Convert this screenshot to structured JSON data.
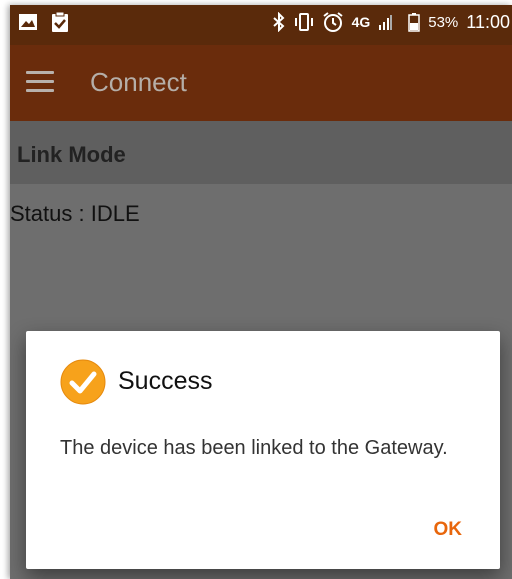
{
  "statusbar": {
    "battery": "53%",
    "time": "11:00",
    "network": "4G",
    "icons": [
      "image-icon",
      "clipboard-check-icon",
      "bluetooth-icon",
      "vibrate-icon",
      "alarm-icon",
      "signal-icon",
      "battery-icon"
    ]
  },
  "toolbar": {
    "title": "Connect"
  },
  "section": {
    "title": "Link Mode"
  },
  "status": {
    "text": "Status : IDLE"
  },
  "dialog": {
    "title": "Success",
    "message": "The device has been linked to the Gateway.",
    "ok_label": "OK"
  },
  "colors": {
    "statusbar_bg": "#5a2a0b",
    "toolbar_bg": "#6a2c0c",
    "accent": "#e8660c",
    "check_icon": "#f7a21b"
  }
}
